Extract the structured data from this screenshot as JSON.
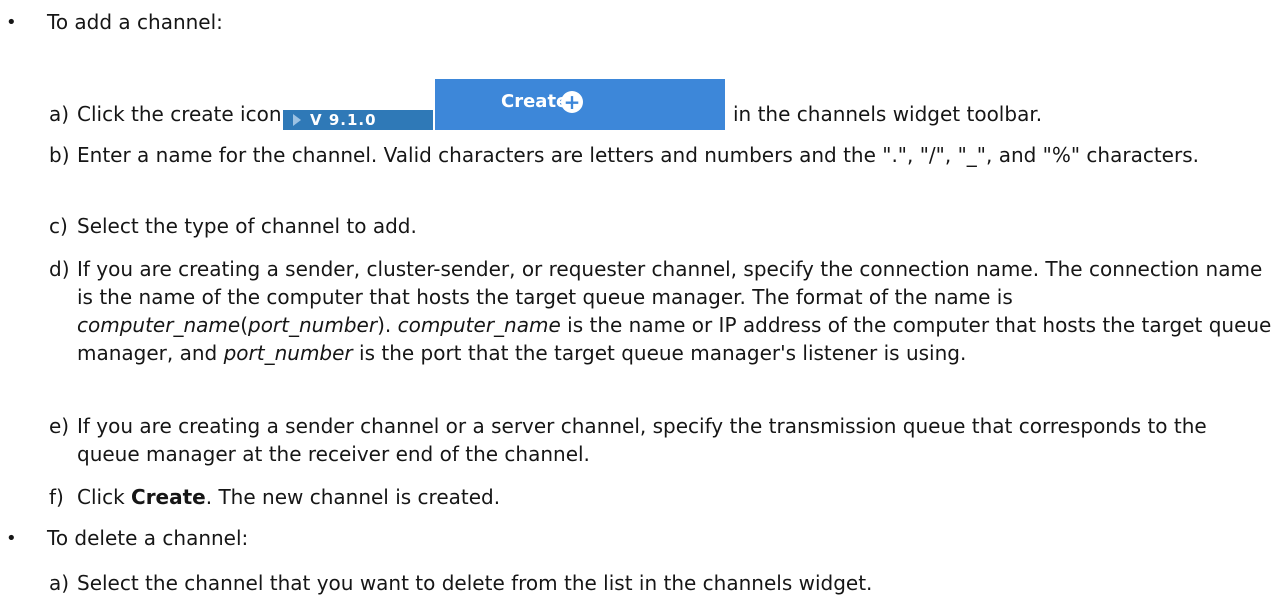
{
  "bullet_glyph": "•",
  "sections": [
    {
      "text": "To add a channel:"
    },
    {
      "text": "To delete a channel:"
    }
  ],
  "add_steps": {
    "a": {
      "letter": "a)",
      "before": "Click the create icon",
      "version_badge": "V 9.1.0",
      "create_button": "Create",
      "plus_glyph": "+",
      "after": "in the channels widget toolbar."
    },
    "b": {
      "letter": "b)",
      "text": "Enter a name for the channel. Valid characters are letters and numbers and the \".\", \"/\", \"_\", and \"%\" characters."
    },
    "c": {
      "letter": "c)",
      "text": "Select the type of channel to add."
    },
    "d": {
      "letter": "d)",
      "t1": "If you are creating a sender, cluster-sender, or requester channel, specify the connection name. The connection name is the name of the computer that hosts the target queue manager. The format of the name is ",
      "i1": "computer_name",
      "t2": "(",
      "i2": "port_number",
      "t3": "). ",
      "i3": "computer_name",
      "t4": " is the name or IP address of the computer that hosts the target queue manager, and ",
      "i4": "port_number",
      "t5": " is the port that the target queue manager's listener is using."
    },
    "e": {
      "letter": "e)",
      "text": "If you are creating a sender channel or a server channel, specify the transmission queue that corresponds to the queue manager at the receiver end of the channel."
    },
    "f": {
      "letter": "f)",
      "pre": "Click ",
      "bold": "Create",
      "post": ". The new channel is created."
    }
  },
  "delete_steps": {
    "a": {
      "letter": "a)",
      "text": "Select the channel that you want to delete from the list in the channels widget."
    }
  },
  "colors": {
    "badge_bg": "#2f79b7",
    "button_bg": "#3d87d9",
    "text": "#161616"
  }
}
